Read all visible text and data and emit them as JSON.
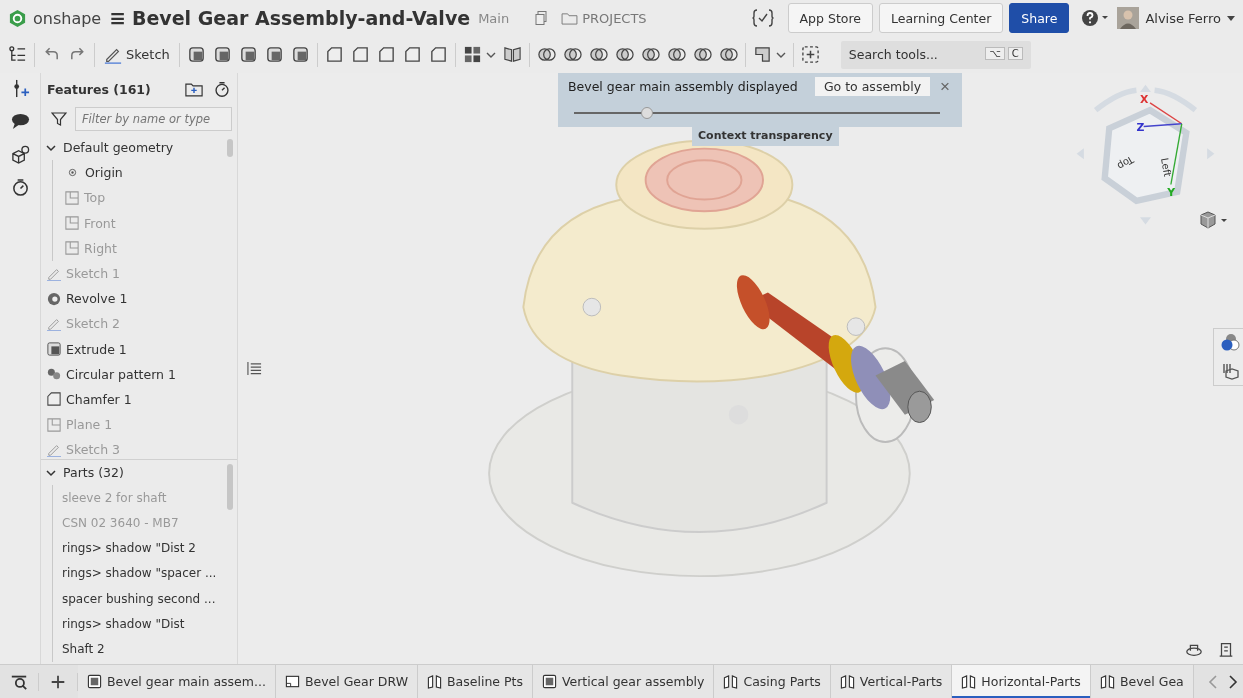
{
  "header": {
    "brand": "onshape",
    "menu_icon": "≡",
    "title": "Bevel Gear Assembly-and-Valve",
    "branch": "Main",
    "projects": "PROJECTS",
    "buttons": [
      {
        "label": "App Store",
        "kind": "plain"
      },
      {
        "label": "Learning Center",
        "kind": "plain"
      },
      {
        "label": "Share",
        "kind": "primary"
      }
    ],
    "user": "Alvise Ferro"
  },
  "toolbar": {
    "sketch": "Sketch",
    "search": {
      "placeholder": "Search tools...",
      "keys": [
        "⌥",
        "C"
      ]
    }
  },
  "features": {
    "title": "Features (161)",
    "filter": {
      "placeholder": "Filter by name or type"
    },
    "items": [
      {
        "label": "Default geometry",
        "kind": "group",
        "expanded": true,
        "children": [
          {
            "label": "Origin",
            "kind": "origin",
            "dimmed": false
          },
          {
            "label": "Top",
            "kind": "plane",
            "dimmed": true
          },
          {
            "label": "Front",
            "kind": "plane",
            "dimmed": true
          },
          {
            "label": "Right",
            "kind": "plane",
            "dimmed": true
          }
        ]
      },
      {
        "label": "Sketch 1",
        "kind": "sketch",
        "dimmed": true
      },
      {
        "label": "Revolve 1",
        "kind": "revolve",
        "dimmed": false
      },
      {
        "label": "Sketch 2",
        "kind": "sketch",
        "dimmed": true
      },
      {
        "label": "Extrude 1",
        "kind": "extrude",
        "dimmed": false
      },
      {
        "label": "Circular pattern 1",
        "kind": "pattern",
        "dimmed": false
      },
      {
        "label": "Chamfer 1",
        "kind": "chamfer",
        "dimmed": false
      },
      {
        "label": "Plane 1",
        "kind": "plane",
        "dimmed": true
      },
      {
        "label": "Sketch 3",
        "kind": "sketch",
        "dimmed": true
      }
    ]
  },
  "parts": {
    "title": "Parts (32)",
    "expanded": true,
    "items": [
      {
        "label": "sleeve 2 for shaft",
        "dimmed": true
      },
      {
        "label": "CSN 02 3640 - MB7",
        "dimmed": true
      },
      {
        "label": "rings> shadow \"Dist 2",
        "dimmed": false
      },
      {
        "label": "rings> shadow \"spacer ...",
        "dimmed": false
      },
      {
        "label": "spacer bushing second ...",
        "dimmed": false
      },
      {
        "label": "rings> shadow \"Dist",
        "dimmed": false
      },
      {
        "label": "Shaft 2",
        "dimmed": false
      }
    ]
  },
  "context_bar": {
    "message": "Bevel gear main assembly displayed",
    "button": "Go to assembly",
    "close": "×",
    "slider": {
      "level": 0.2
    },
    "tooltip": "Context transparency"
  },
  "view_cube": {
    "faces": [
      "Top",
      "Left"
    ],
    "axes": [
      "X",
      "Y",
      "Z"
    ]
  },
  "tabs": [
    {
      "label": "Bevel gear main assem...",
      "kind": "assembly",
      "selected": false
    },
    {
      "label": "Bevel Gear DRW",
      "kind": "drawing",
      "selected": false
    },
    {
      "label": "Baseline Pts",
      "kind": "partstudio",
      "selected": false
    },
    {
      "label": "Vertical gear assembly",
      "kind": "assembly",
      "selected": false
    },
    {
      "label": "Casing Parts",
      "kind": "partstudio",
      "selected": false
    },
    {
      "label": "Vertical-Parts",
      "kind": "partstudio",
      "selected": false
    },
    {
      "label": "Horizontal-Parts",
      "kind": "partstudio",
      "selected": true
    },
    {
      "label": "Bevel Gea",
      "kind": "partstudio",
      "selected": false
    }
  ]
}
